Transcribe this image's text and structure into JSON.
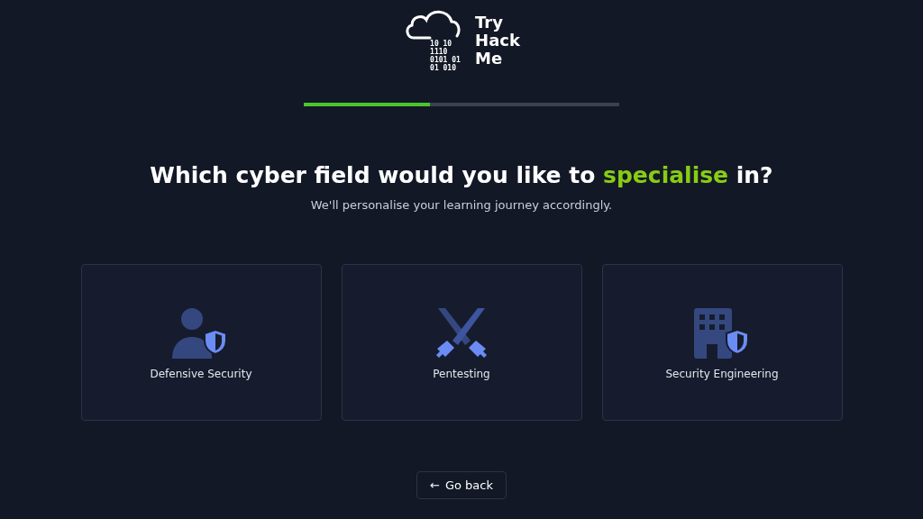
{
  "logo": {
    "binary": [
      "10 10",
      "1110",
      "0101 01",
      "01 010"
    ],
    "wordmark": [
      "Try",
      "Hack",
      "Me"
    ]
  },
  "progress": {
    "level": 0.4
  },
  "heading": {
    "before": "Which cyber field would you like to ",
    "highlight": "specialise",
    "after": " in?"
  },
  "subtitle": "We'll personalise your learning journey accordingly.",
  "options": [
    {
      "kind": "user-shield",
      "label": "Defensive Security"
    },
    {
      "kind": "swords",
      "label": "Pentesting"
    },
    {
      "kind": "building-shield",
      "label": "Security Engineering"
    }
  ],
  "back_button": {
    "arrow": "←",
    "label": "Go back"
  }
}
